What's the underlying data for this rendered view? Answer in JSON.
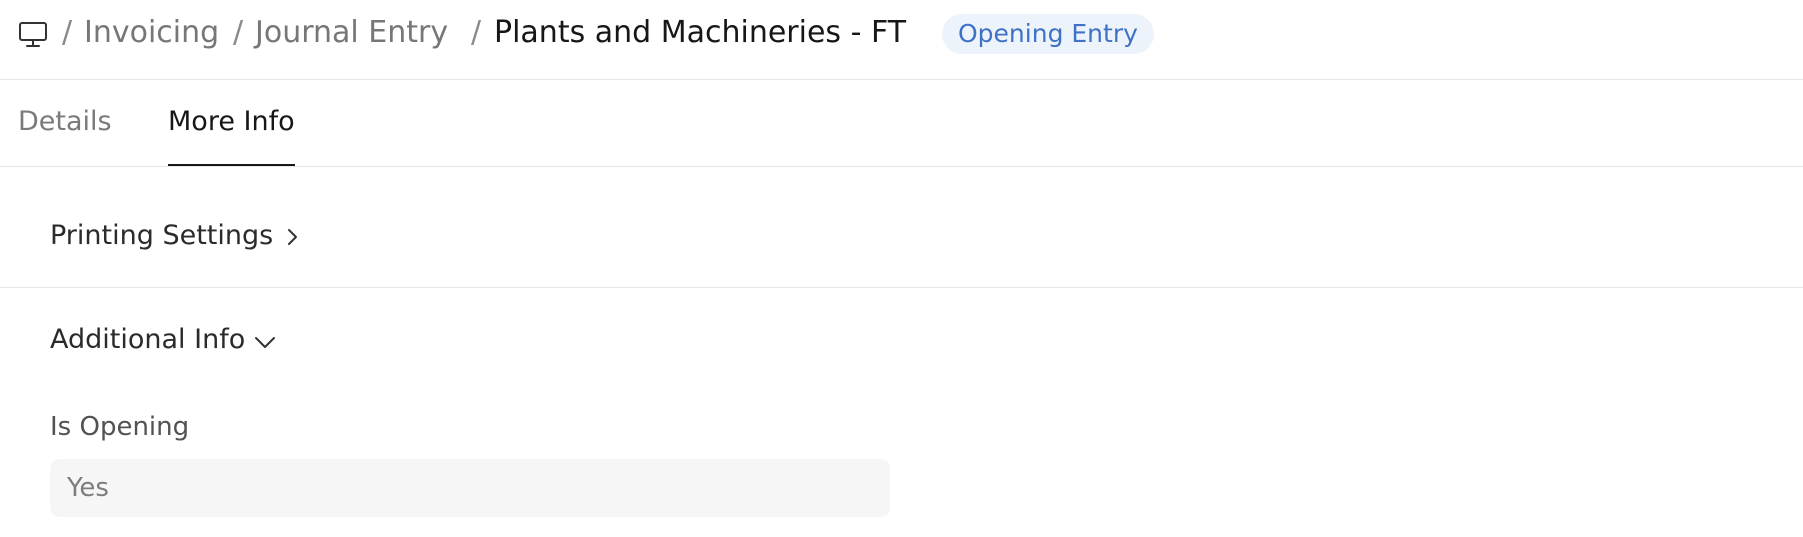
{
  "breadcrumb": {
    "separator": "/",
    "items": [
      "Invoicing",
      "Journal Entry"
    ],
    "title": "Plants and Machineries - FT",
    "badge": "Opening Entry"
  },
  "tabs": [
    {
      "label": "Details",
      "active": false
    },
    {
      "label": "More Info",
      "active": true
    }
  ],
  "sections": {
    "printing": {
      "title": "Printing Settings",
      "expanded": false
    },
    "additional": {
      "title": "Additional Info",
      "expanded": true,
      "fields": [
        {
          "label": "Is Opening",
          "value": "Yes"
        }
      ]
    }
  },
  "icons": {
    "home": "desktop-icon",
    "printing_toggle": "chevron-right-icon",
    "additional_toggle": "chevron-down-icon"
  },
  "colors": {
    "badge_bg": "#edf3fb",
    "badge_text": "#3f72c4",
    "field_bg": "#f6f6f6",
    "active_tab": "#171717"
  }
}
